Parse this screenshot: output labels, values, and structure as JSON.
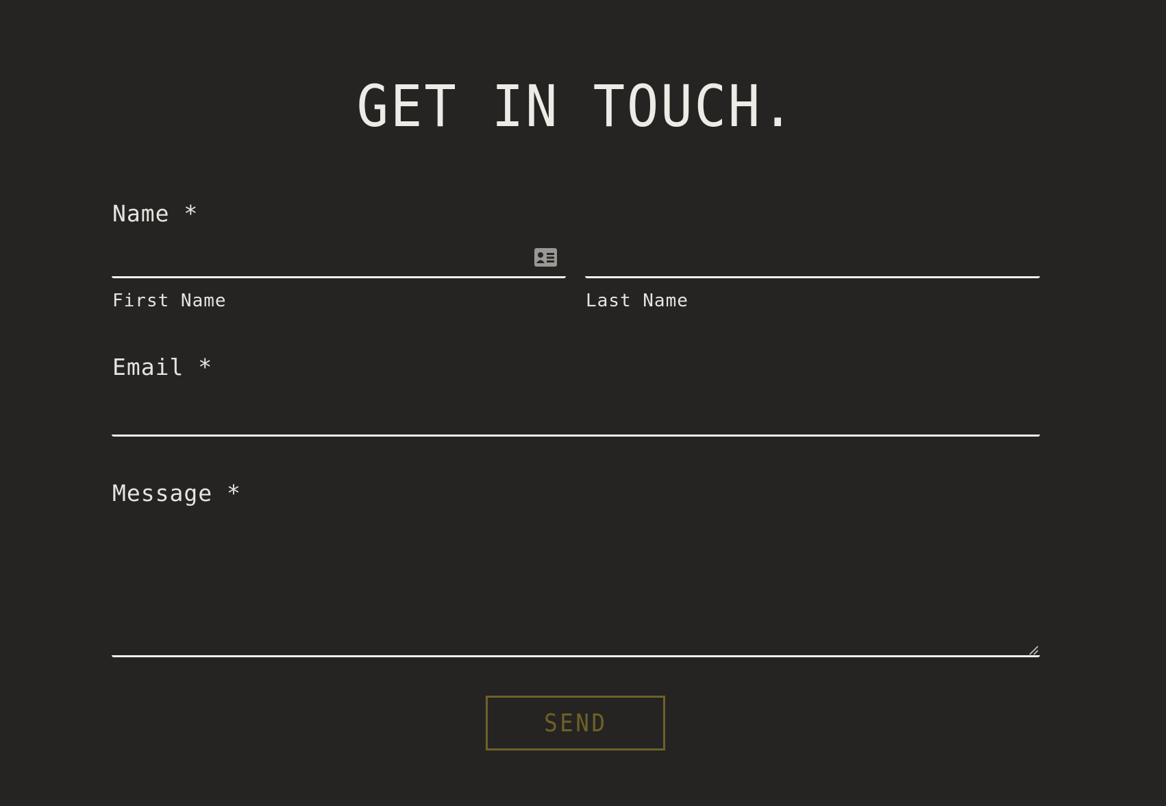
{
  "page": {
    "title": "GET IN TOUCH."
  },
  "form": {
    "name": {
      "label": "Name *",
      "first_name_label": "First Name",
      "first_name_value": "",
      "last_name_label": "Last Name",
      "last_name_value": "",
      "autofill_icon": "contact-card-icon"
    },
    "email": {
      "label": "Email *",
      "value": ""
    },
    "message": {
      "label": "Message *",
      "value": ""
    },
    "submit_label": "SEND"
  },
  "colors": {
    "background": "#252422",
    "text": "#e9e7e2",
    "input_underline": "#f2f1ee",
    "accent": "#6e6128",
    "icon": "#9a9893"
  }
}
